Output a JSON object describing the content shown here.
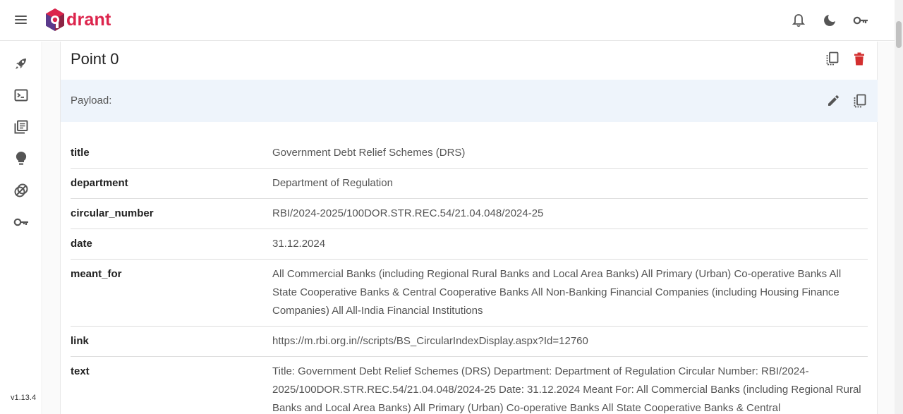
{
  "app": {
    "logo_text": "drant",
    "version": "v1.13.4"
  },
  "topbar": {
    "icons": [
      "menu-icon",
      "bell-icon",
      "moon-icon",
      "key-icon"
    ]
  },
  "sidebar": {
    "items": [
      "rocket-icon",
      "console-icon",
      "collections-icon",
      "lightbulb-icon",
      "datasets-icon",
      "key-icon"
    ]
  },
  "point": {
    "title": "Point 0"
  },
  "payload": {
    "label": "Payload:",
    "rows": [
      {
        "key": "title",
        "value": "Government Debt Relief Schemes (DRS)"
      },
      {
        "key": "department",
        "value": "Department of Regulation"
      },
      {
        "key": "circular_number",
        "value": "RBI/2024-2025/100DOR.STR.REC.54/21.04.048/2024-25"
      },
      {
        "key": "date",
        "value": "31.12.2024"
      },
      {
        "key": "meant_for",
        "value": "All Commercial Banks (including Regional Rural Banks and Local Area Banks) All Primary (Urban) Co-operative Banks All State Cooperative Banks & Central Cooperative Banks All Non-Banking Financial Companies (including Housing Finance Companies) All All-India Financial Institutions"
      },
      {
        "key": "link",
        "value": "https://m.rbi.org.in//scripts/BS_CircularIndexDisplay.aspx?Id=12760"
      },
      {
        "key": "text",
        "value": "Title: Government Debt Relief Schemes (DRS) Department: Department of Regulation Circular Number: RBI/2024-2025/100DOR.STR.REC.54/21.04.048/2024-25 Date: 31.12.2024 Meant For: All Commercial Banks (including Regional Rural Banks and Local Area Banks) All Primary (Urban) Co-operative Banks All State Cooperative Banks & Central"
      }
    ]
  },
  "colors": {
    "brand": "#dc244c",
    "delete": "#d32f2f",
    "payload_bg": "#eef4fb"
  }
}
